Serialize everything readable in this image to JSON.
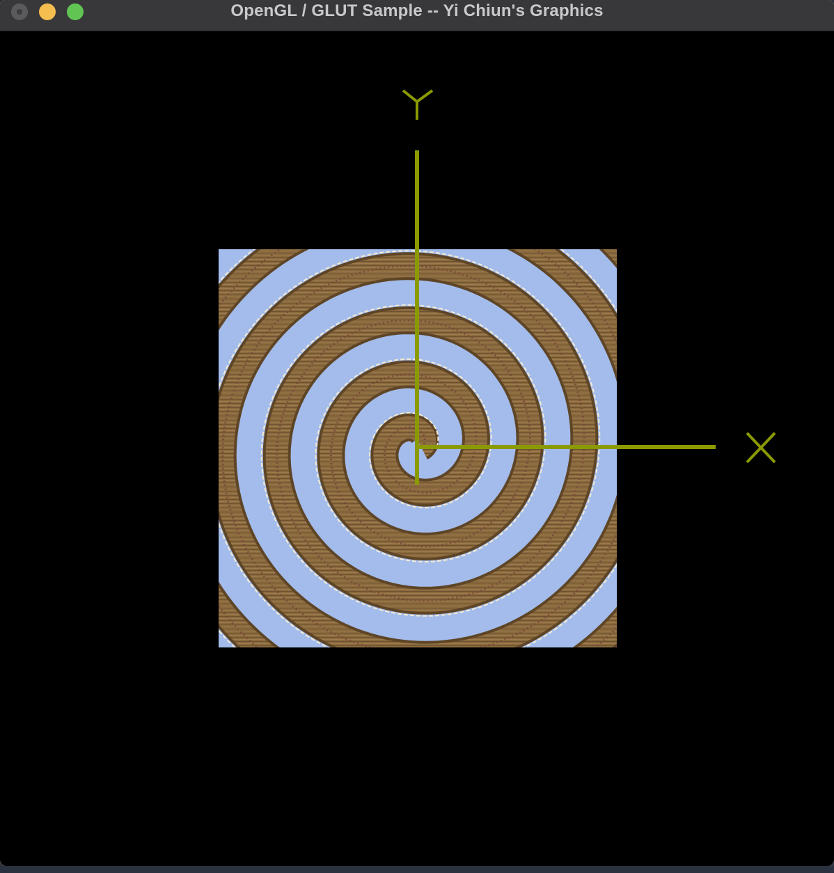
{
  "window": {
    "title": "OpenGL / GLUT Sample -- Yi Chiun's Graphics",
    "buttons": [
      "close",
      "minimize",
      "zoom"
    ]
  },
  "scene": {
    "background_color": "#000000",
    "axis_color": "#8a9a00",
    "axes": {
      "x_label": "X",
      "y_label": "Y"
    },
    "textured_quad": {
      "texture": "spiral-wood-texture",
      "colors": {
        "wood": "#8a6a3e",
        "wood_dark": "#5e4526",
        "blue": "#a3bcec"
      }
    }
  }
}
